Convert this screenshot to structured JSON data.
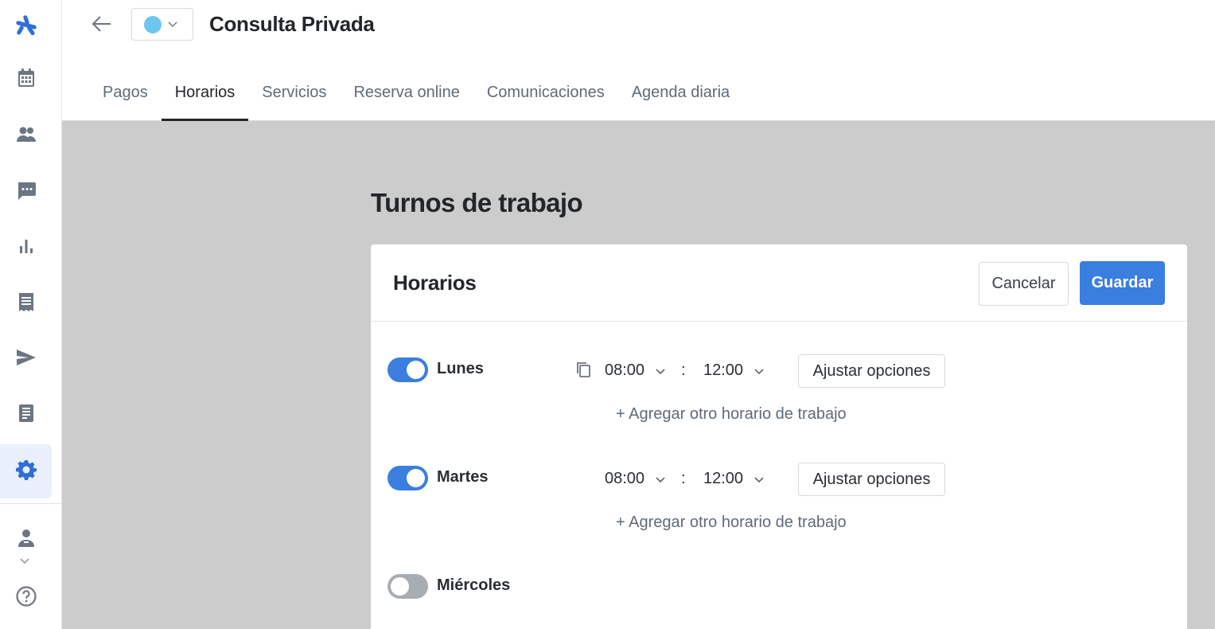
{
  "header": {
    "title": "Consulta Privada",
    "color_dot": "#6ec6f0"
  },
  "tabs": [
    {
      "label": "Pagos",
      "active": false
    },
    {
      "label": "Horarios",
      "active": true
    },
    {
      "label": "Servicios",
      "active": false
    },
    {
      "label": "Reserva online",
      "active": false
    },
    {
      "label": "Comunicaciones",
      "active": false
    },
    {
      "label": "Agenda diaria",
      "active": false
    }
  ],
  "sidebar": {
    "items": [
      {
        "icon": "logo-icon"
      },
      {
        "icon": "calendar-icon"
      },
      {
        "icon": "patients-icon"
      },
      {
        "icon": "messages-icon"
      },
      {
        "icon": "stats-icon"
      },
      {
        "icon": "invoice-icon"
      },
      {
        "icon": "send-icon"
      },
      {
        "icon": "records-icon"
      },
      {
        "icon": "settings-icon",
        "active": true
      },
      {
        "icon": "doctor-profile-icon"
      },
      {
        "icon": "help-icon"
      }
    ]
  },
  "main": {
    "section_title": "Turnos de trabajo",
    "card": {
      "title": "Horarios",
      "cancel_label": "Cancelar",
      "save_label": "Guardar",
      "days": [
        {
          "name": "Lunes",
          "enabled": true,
          "from": "08:00",
          "to": "12:00",
          "separator": ":",
          "adjust_label": "Ajustar opciones",
          "add_label": "+ Agregar otro horario de trabajo"
        },
        {
          "name": "Martes",
          "enabled": true,
          "from": "08:00",
          "to": "12:00",
          "separator": ":",
          "adjust_label": "Ajustar opciones",
          "add_label": "+ Agregar otro horario de trabajo"
        },
        {
          "name": "Miércoles",
          "enabled": false
        }
      ]
    }
  },
  "colors": {
    "accent": "#3a7ee0",
    "brand": "#2f6fd6",
    "toggle_off": "#a8adb3",
    "background_grey": "#cccccc"
  }
}
